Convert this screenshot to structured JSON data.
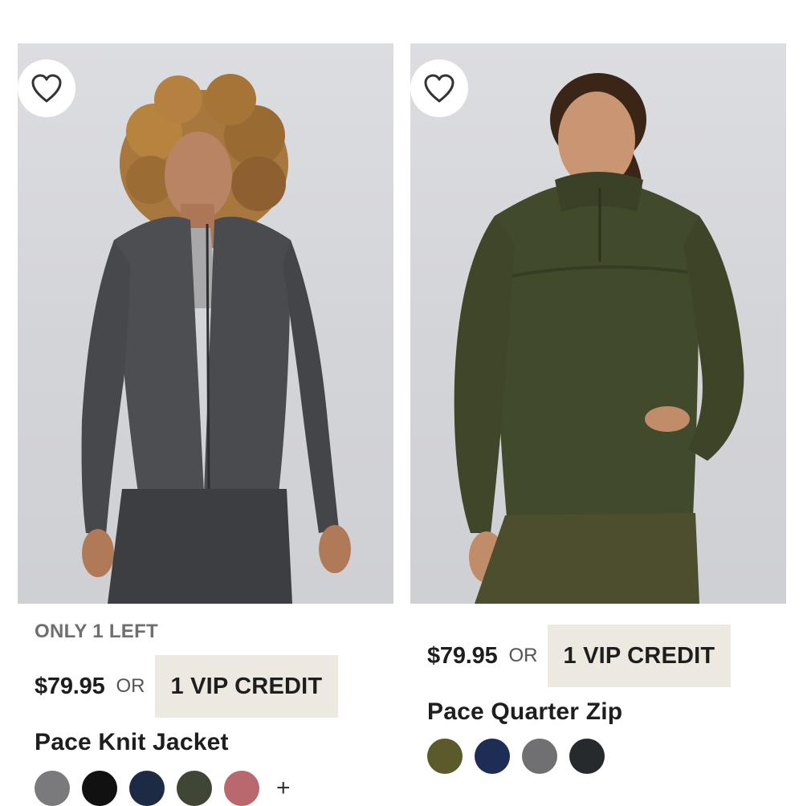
{
  "products": [
    {
      "stock_label": "ONLY 1 LEFT",
      "price": "$79.95",
      "or_label": "OR",
      "vip_label": "1 VIP CREDIT",
      "name": "Pace Knit Jacket",
      "favorite_icon": "heart-outline-icon",
      "swatch_colors": [
        "#7a7a7c",
        "#111111",
        "#1c2a44",
        "#3f4636",
        "#b9686d"
      ],
      "more_colors_label": "+"
    },
    {
      "price": "$79.95",
      "or_label": "OR",
      "vip_label": "1 VIP CREDIT",
      "name": "Pace Quarter Zip",
      "favorite_icon": "heart-outline-icon",
      "swatch_colors": [
        "#5a5a2a",
        "#1e2d55",
        "#707073",
        "#272a2c"
      ]
    }
  ]
}
